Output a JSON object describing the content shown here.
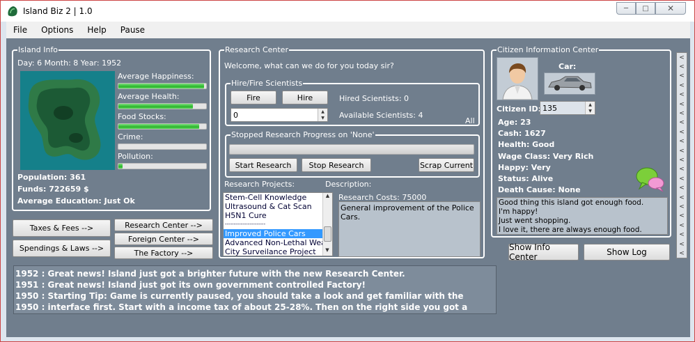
{
  "window": {
    "title": "Island Biz 2 | 1.0",
    "controls": [
      "minimize-icon",
      "restore-icon",
      "close-icon"
    ]
  },
  "menu": [
    "File",
    "Options",
    "Help",
    "Pause"
  ],
  "island_info": {
    "group_label": "Island Info",
    "date": "Day: 6 Month: 8 Year: 1952",
    "bars": [
      {
        "label": "Average Happiness:",
        "value": 0.98
      },
      {
        "label": "Average Health:",
        "value": 0.85
      },
      {
        "label": "Food Stocks:",
        "value": 0.92
      },
      {
        "label": "Crime:",
        "value": 0.0
      },
      {
        "label": "Pollution:",
        "value": 0.05
      }
    ],
    "population": "Population: 361",
    "funds": "Funds: 722659 $",
    "education": "Average Education: Just Ok"
  },
  "left_buttons": {
    "taxes": "Taxes & Fees -->",
    "spendings": "Spendings & Laws -->",
    "research": "Research Center -->",
    "foreign": "Foreign Center -->",
    "factory": "The Factory -->"
  },
  "research_center": {
    "group_label": "Research Center",
    "welcome": "Welcome, what can we do for you today sir?",
    "hire_group_label": "Hire/Fire Scientists",
    "fire_label": "Fire",
    "hire_label": "Hire",
    "amount_value": "0",
    "hired": "Hired Scientists: 0",
    "available": "Available Scientists: 4",
    "all_label": "All",
    "progress_group_label": "Stopped Research Progress on 'None'",
    "progress_value": 0,
    "start_label": "Start Research",
    "stop_label": "Stop Research",
    "scrap_label": "Scrap Current",
    "projects_label": "Research Projects:",
    "description_label": "Description:",
    "projects": [
      {
        "label": "Stem-Cell Knowledge",
        "selected": false
      },
      {
        "label": "Ultrasound & Cat Scan",
        "selected": false
      },
      {
        "label": "H5N1 Cure",
        "selected": false
      },
      {
        "label": "-----------------------",
        "selected": false
      },
      {
        "label": "Improved Police Cars",
        "selected": true
      },
      {
        "label": "Advanced Non-Lethal Weapo",
        "selected": false
      },
      {
        "label": "City Surveilance Project",
        "selected": false
      }
    ],
    "costs": "Research Costs: 75000",
    "description": "General improvement of the Police Cars."
  },
  "citizen": {
    "group_label": "Citizen Information Center",
    "car_label": "Car:",
    "id_label": "Citizen ID:",
    "id_value": "135",
    "age": "Age: 23",
    "cash": "Cash: 1627",
    "health": "Health: Good",
    "wage": "Wage Class: Very Rich",
    "happy": "Happy: Very",
    "status": "Status: Alive",
    "death": "Death Cause: None",
    "thoughts": [
      "Good thing this island got enough food.",
      "I'm happy!",
      "Just went shopping.",
      "I love it, there are always enough food."
    ],
    "show_info_label": "Show Info Center",
    "show_log_label": "Show Log"
  },
  "log_lines": [
    "1952 : Great news! Island just got a brighter future with the new Research Center.",
    "1951 : Great news! Island just got its own government controlled Factory!",
    "1950 : Starting Tip: Game is currently paused, you should take a look and get familiar with the",
    "1950 : interface first. Start with a income tax of about 25-28%. Then on the right side you got a"
  ],
  "side_arrows": "<"
}
